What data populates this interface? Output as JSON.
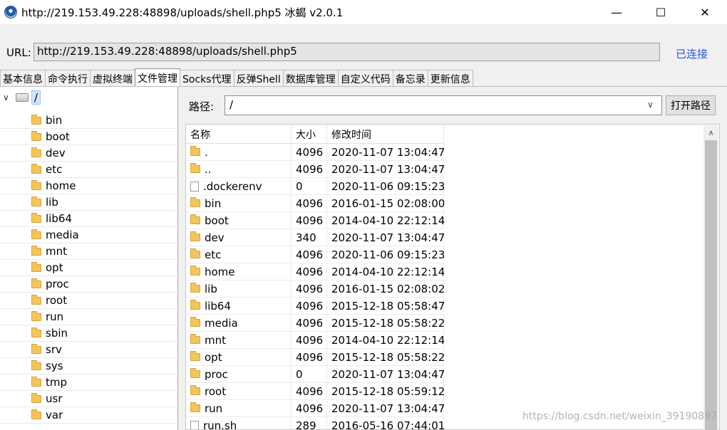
{
  "window": {
    "title": "http://219.153.49.228:48898/uploads/shell.php5    冰蝎 v2.0.1",
    "minimize_glyph": "—",
    "maximize_glyph": "☐",
    "close_glyph": "✕"
  },
  "url_bar": {
    "label": "URL:",
    "value": "http://219.153.49.228:48898/uploads/shell.php5",
    "status": "已连接",
    "status_color": "#1e5cd6"
  },
  "tabs": [
    {
      "label": "基本信息"
    },
    {
      "label": "命令执行"
    },
    {
      "label": "虚拟终端"
    },
    {
      "label": "文件管理",
      "active": true
    },
    {
      "label": "Socks代理"
    },
    {
      "label": "反弹Shell"
    },
    {
      "label": "数据库管理"
    },
    {
      "label": "自定义代码"
    },
    {
      "label": "备忘录"
    },
    {
      "label": "更新信息"
    }
  ],
  "tree": {
    "root": "/",
    "items": [
      "bin",
      "boot",
      "dev",
      "etc",
      "home",
      "lib",
      "lib64",
      "media",
      "mnt",
      "opt",
      "proc",
      "root",
      "run",
      "sbin",
      "srv",
      "sys",
      "tmp",
      "usr",
      "var"
    ]
  },
  "path_bar": {
    "label": "路径:",
    "value": "/",
    "open_button": "打开路径"
  },
  "file_table": {
    "columns": {
      "name": "名称",
      "size": "大小",
      "mtime": "修改时间"
    },
    "rows": [
      {
        "icon": "folder",
        "name": ".",
        "size": "4096",
        "mtime": "2020-11-07 13:04:47"
      },
      {
        "icon": "folder",
        "name": "..",
        "size": "4096",
        "mtime": "2020-11-07 13:04:47"
      },
      {
        "icon": "file",
        "name": ".dockerenv",
        "size": "0",
        "mtime": "2020-11-06 09:15:23"
      },
      {
        "icon": "folder",
        "name": "bin",
        "size": "4096",
        "mtime": "2016-01-15 02:08:00"
      },
      {
        "icon": "folder",
        "name": "boot",
        "size": "4096",
        "mtime": "2014-04-10 22:12:14"
      },
      {
        "icon": "folder",
        "name": "dev",
        "size": "340",
        "mtime": "2020-11-07 13:04:47"
      },
      {
        "icon": "folder",
        "name": "etc",
        "size": "4096",
        "mtime": "2020-11-06 09:15:23"
      },
      {
        "icon": "folder",
        "name": "home",
        "size": "4096",
        "mtime": "2014-04-10 22:12:14"
      },
      {
        "icon": "folder",
        "name": "lib",
        "size": "4096",
        "mtime": "2016-01-15 02:08:02"
      },
      {
        "icon": "folder",
        "name": "lib64",
        "size": "4096",
        "mtime": "2015-12-18 05:58:47"
      },
      {
        "icon": "folder",
        "name": "media",
        "size": "4096",
        "mtime": "2015-12-18 05:58:22"
      },
      {
        "icon": "folder",
        "name": "mnt",
        "size": "4096",
        "mtime": "2014-04-10 22:12:14"
      },
      {
        "icon": "folder",
        "name": "opt",
        "size": "4096",
        "mtime": "2015-12-18 05:58:22"
      },
      {
        "icon": "folder",
        "name": "proc",
        "size": "0",
        "mtime": "2020-11-07 13:04:47"
      },
      {
        "icon": "folder",
        "name": "root",
        "size": "4096",
        "mtime": "2015-12-18 05:59:12"
      },
      {
        "icon": "folder",
        "name": "run",
        "size": "4096",
        "mtime": "2020-11-07 13:04:47"
      },
      {
        "icon": "file",
        "name": "run.sh",
        "size": "289",
        "mtime": "2016-05-16 07:44:01"
      }
    ]
  },
  "watermark": "https://blog.csdn.net/weixin_39190897"
}
